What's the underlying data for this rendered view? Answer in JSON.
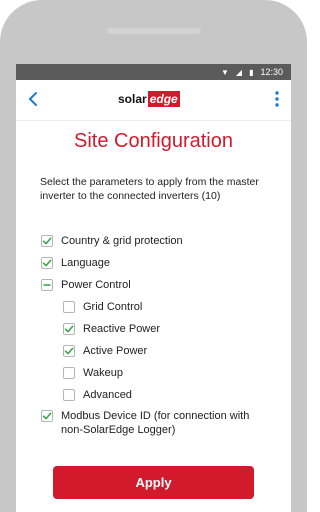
{
  "status_bar": {
    "time": "12:30"
  },
  "app_bar": {
    "logo_solar": "solar",
    "logo_edge": "edge"
  },
  "page": {
    "title": "Site Configuration",
    "description": "Select the parameters to apply from the master inverter to the connected inverters (10)"
  },
  "options": [
    {
      "label": "Country & grid protection",
      "state": "checked"
    },
    {
      "label": "Language",
      "state": "checked"
    },
    {
      "label": "Power Control",
      "state": "indeterminate"
    },
    {
      "label": "Grid Control",
      "state": "unchecked"
    },
    {
      "label": "Reactive Power",
      "state": "checked"
    },
    {
      "label": "Active Power",
      "state": "checked"
    },
    {
      "label": "Wakeup",
      "state": "unchecked"
    },
    {
      "label": "Advanced",
      "state": "unchecked"
    },
    {
      "label": "Modbus Device ID (for connection with non-SolarEdge Logger)",
      "state": "checked"
    }
  ],
  "actions": {
    "apply_label": "Apply"
  },
  "colors": {
    "accent": "#d31a2d",
    "check": "#3aa34a"
  }
}
